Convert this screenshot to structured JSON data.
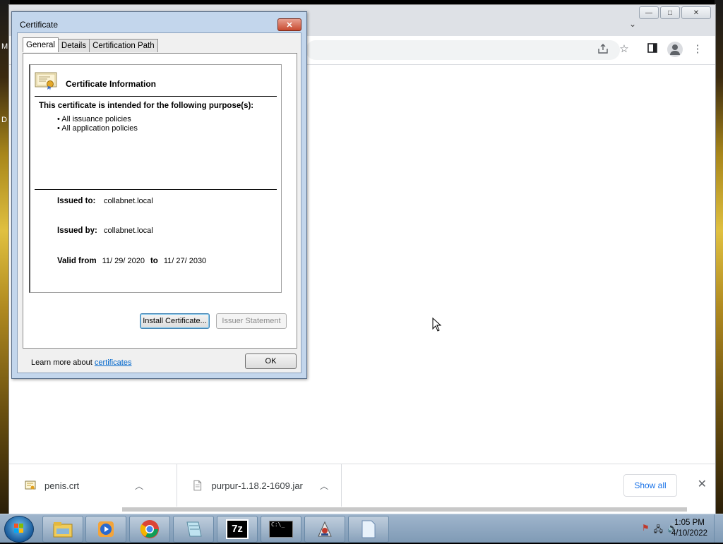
{
  "desktop": {
    "edge_labels": [
      "M",
      "D"
    ]
  },
  "chrome": {
    "window_buttons": {
      "minimize": "—",
      "maximize": "□",
      "close": "✕"
    },
    "tab_dropdown_icon": "chevron-down-icon",
    "toolbar_icons": [
      "share-icon",
      "star-icon",
      "side-panel-icon",
      "profile-icon",
      "more-icon"
    ]
  },
  "dialog": {
    "title": "Certificate",
    "close_glyph": "✕",
    "tabs": [
      {
        "label": "General",
        "active": true
      },
      {
        "label": "Details",
        "active": false
      },
      {
        "label": "Certification Path",
        "active": false
      }
    ],
    "info_title": "Certificate Information",
    "purpose_heading": "This certificate is intended for the following purpose(s):",
    "purposes": [
      "• All issuance policies",
      "• All application policies"
    ],
    "issued_to_label": "Issued to:",
    "issued_to": "collabnet.local",
    "issued_by_label": "Issued by:",
    "issued_by": "collabnet.local",
    "valid_from_label": "Valid from",
    "valid_from": "11/ 29/ 2020",
    "valid_to_label": "to",
    "valid_to": "11/ 27/ 2030",
    "install_button": "Install Certificate...",
    "issuer_statement_button": "Issuer Statement",
    "learn_more_prefix": "Learn more about ",
    "learn_more_link": "certificates",
    "ok_button": "OK"
  },
  "downloads": {
    "items": [
      {
        "name": "penis.crt",
        "icon": "certificate-file-icon"
      },
      {
        "name": "purpur-1.18.2-1609.jar",
        "icon": "jar-file-icon"
      }
    ],
    "show_all": "Show all",
    "close_glyph": "✕"
  },
  "taskbar": {
    "apps": [
      "explorer",
      "media-player",
      "chrome",
      "notepad",
      "7zip",
      "command-prompt",
      "java",
      "blank-document"
    ],
    "clock_time": "1:05 PM",
    "clock_date": "4/10/2022",
    "sevenzip_label": "7z",
    "cmd_label": "C:\\_"
  }
}
